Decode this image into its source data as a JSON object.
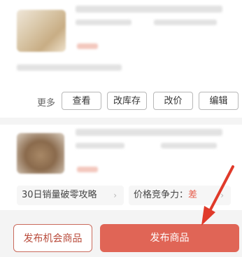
{
  "card1": {
    "actions_more_label": "更多",
    "actions": [
      "查看",
      "改库存",
      "改价",
      "编辑"
    ]
  },
  "card2": {
    "tip_left": "30日销量破零攻略",
    "tip_right_label": "价格竞争力：",
    "tip_right_value": "差",
    "chevron": "›"
  },
  "footer": {
    "publish_opportunity": "发布机会商品",
    "publish_product": "发布商品"
  },
  "colors": {
    "accent": "#e06556",
    "annotation_arrow": "#e03a2a"
  },
  "icons": [
    "chevron-right-icon",
    "annotation-arrow-icon"
  ]
}
